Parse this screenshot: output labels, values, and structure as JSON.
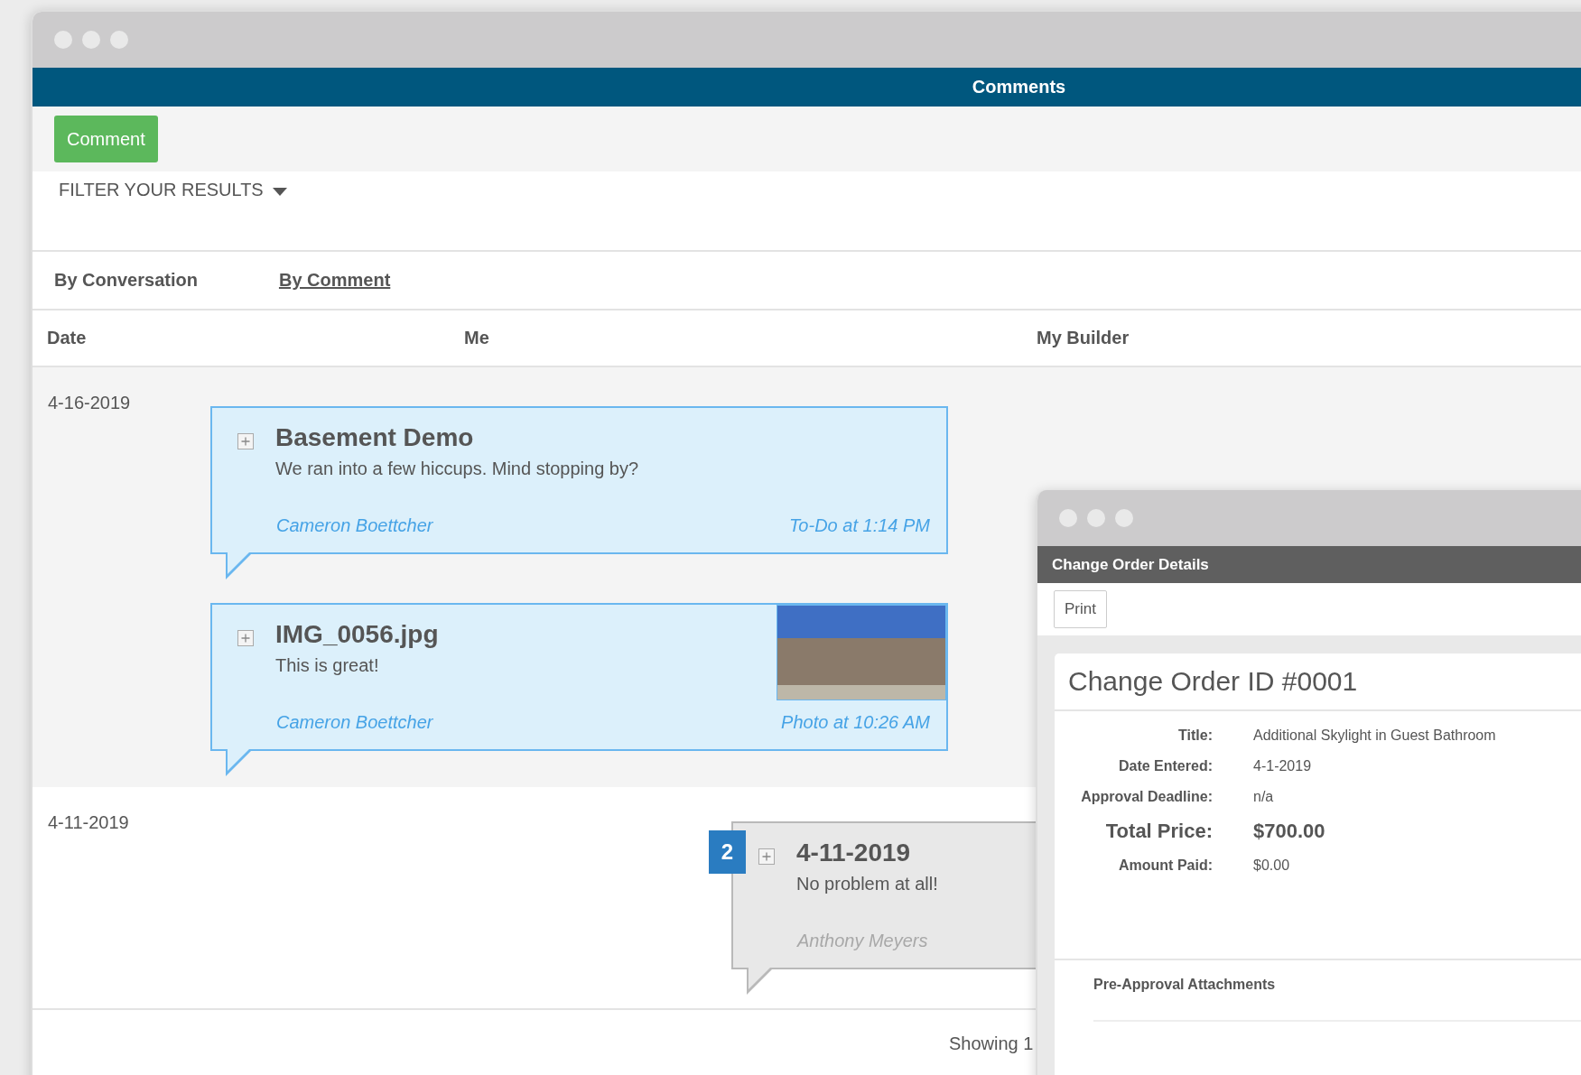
{
  "main_window": {
    "header": "Comments",
    "comment_button": "Comment",
    "filter": "FILTER YOUR RESULTS",
    "tabs": [
      {
        "label": "By Conversation",
        "selected": true
      },
      {
        "label": "By Comment",
        "selected": false
      }
    ],
    "columns": [
      "Date",
      "Me",
      "My Builder"
    ],
    "groups": [
      {
        "date": "4-16-2019",
        "comments": [
          {
            "kind": "me",
            "title": "Basement Demo",
            "body": "We ran into a few hiccups. Mind stopping by?",
            "author": "Cameron Boettcher",
            "meta": "To-Do at 1:14 PM",
            "photo": false
          },
          {
            "kind": "me",
            "title": "IMG_0056.jpg",
            "body": "This is great!",
            "author": "Cameron Boettcher",
            "meta": "Photo at 10:26 AM",
            "photo": true
          }
        ]
      },
      {
        "date": "4-11-2019",
        "comments": [
          {
            "kind": "builder",
            "badge": "2",
            "title": "4-11-2019",
            "body": "No problem at all!",
            "author": "Anthony Meyers",
            "photo": false
          }
        ]
      }
    ],
    "footer": "Showing 1"
  },
  "details_window": {
    "header": "Change Order Details",
    "print_button": "Print",
    "heading": "Change Order ID #0001",
    "fields": [
      {
        "label": "Title:",
        "value": "Additional Skylight in Guest Bathroom",
        "emphasis": false
      },
      {
        "label": "Date Entered:",
        "value": "4-1-2019",
        "emphasis": false
      },
      {
        "label": "Approval Deadline:",
        "value": "n/a",
        "emphasis": false
      },
      {
        "label": "Total Price:",
        "value": "$700.00",
        "emphasis": true
      },
      {
        "label": "Amount Paid:",
        "value": "$0.00",
        "emphasis": false
      }
    ],
    "section": "Pre-Approval Attachments"
  }
}
